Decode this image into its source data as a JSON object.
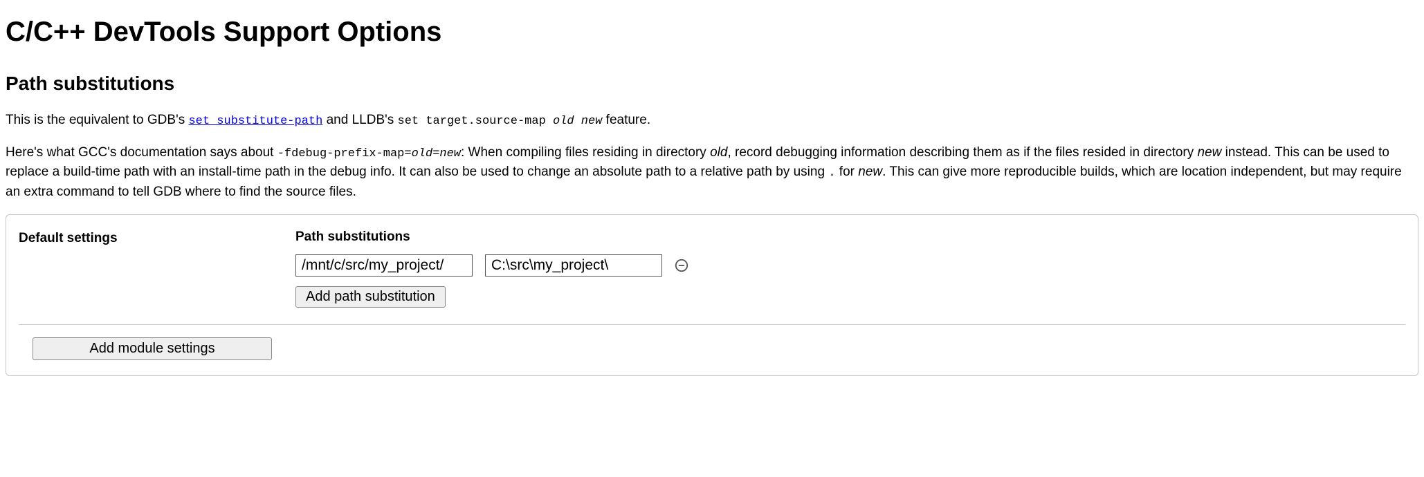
{
  "page": {
    "title": "C/C++ DevTools Support Options",
    "section_heading": "Path substitutions"
  },
  "intro": {
    "p1_pre": "This is the equivalent to GDB's ",
    "gdb_link_text": "set substitute-path",
    "p1_mid": " and LLDB's ",
    "lldb_cmd_prefix": "set target.source-map ",
    "lldb_cmd_old": "old",
    "lldb_cmd_new": "new",
    "p1_post": " feature."
  },
  "explain": {
    "pre": "Here's what GCC's documentation says about ",
    "flag_prefix": "-fdebug-prefix-map=",
    "flag_old": "old",
    "flag_eq": "=",
    "flag_new": "new",
    "after_flag": ": When compiling files residing in directory ",
    "old_word": "old",
    "seg2": ", record debugging information describing them as if the files resided in directory ",
    "new_word": "new",
    "seg3": " instead. This can be used to replace a build-time path with an install-time path in the debug info. It can also be used to change an absolute path to a relative path by using ",
    "dot": ".",
    "seg4": " for ",
    "new_word2": "new",
    "seg5": ". This can give more reproducible builds, which are location independent, but may require an extra command to tell GDB where to find the source files."
  },
  "settings": {
    "default_label": "Default settings",
    "pathsub_label": "Path substitutions",
    "row": {
      "from": "/mnt/c/src/my_project/",
      "to": "C:\\src\\my_project\\"
    },
    "add_path_label": "Add path substitution",
    "add_module_label": "Add module settings"
  }
}
